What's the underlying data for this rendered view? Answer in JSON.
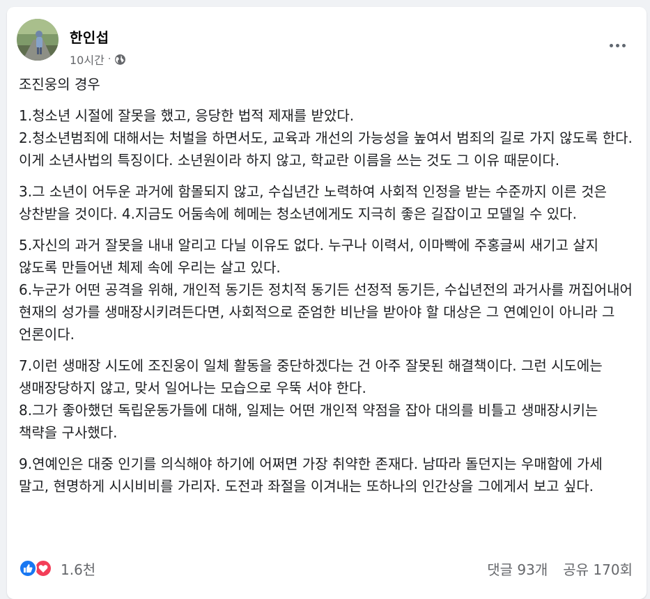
{
  "post": {
    "author": "한인섭",
    "timestamp": "10시간",
    "separator": "·",
    "privacy_icon": "globe-icon",
    "more_icon": "more-options-icon",
    "paragraphs": [
      "조진웅의 경우",
      "1.청소년 시절에 잘못을 했고, 응당한 법적 제재를 받았다.\n2.청소년범죄에 대해서는 처벌을 하면서도, 교육과 개선의 가능성을 높여서 범죄의 길로 가지 않도록 한다. 이게 소년사법의 특징이다. 소년원이라 하지 않고, 학교란 이름을 쓰는 것도 그 이유 때문이다.",
      "3.그 소년이 어두운 과거에 함몰되지 않고, 수십년간 노력하여 사회적 인정을 받는 수준까지 이른 것은 상찬받을 것이다. 4.지금도 어둠속에 헤메는 청소년에게도 지극히 좋은 길잡이고 모델일 수 있다.",
      "5.자신의 과거 잘못을 내내 알리고 다닐 이유도 없다. 누구나 이력서, 이마빡에 주홍글씨 새기고 살지 않도록 만들어낸 체제 속에 우리는 살고 있다.\n6.누군가 어떤 공격을 위해, 개인적 동기든 정치적 동기든 선정적 동기든, 수십년전의 과거사를 꺼집어내어 현재의 성가를 생매장시키려든다면, 사회적으로 준엄한 비난을 받아야 할 대상은 그 연예인이 아니라 그 언론이다.",
      "7.이런 생매장 시도에 조진웅이 일체 활동을 중단하겠다는 건 아주 잘못된 해결책이다. 그런 시도에는 생매장당하지 않고, 맞서 일어나는 모습으로 우뚝 서야 한다.\n8.그가 좋아했던 독립운동가들에 대해, 일제는 어떤 개인적 약점을 잡아 대의를 비틀고 생매장시키는 책략을 구사했다.",
      "9.연예인은 대중 인기를 의식해야 하기에 어쩌면 가장 취약한 존재다. 남따라 돌던지는 우매함에 가세 말고, 현명하게 시시비비를 가리자. 도전과 좌절을 이겨내는 또하나의 인간상을 그에게서 보고 싶다."
    ],
    "reaction_count": "1.6천",
    "reaction_icons": [
      "like-icon",
      "love-icon"
    ],
    "comments": "댓글 93개",
    "shares": "공유 170회",
    "colors": {
      "like": "#1877f2",
      "love": "#f33e58",
      "secondary_text": "#65676b"
    }
  }
}
